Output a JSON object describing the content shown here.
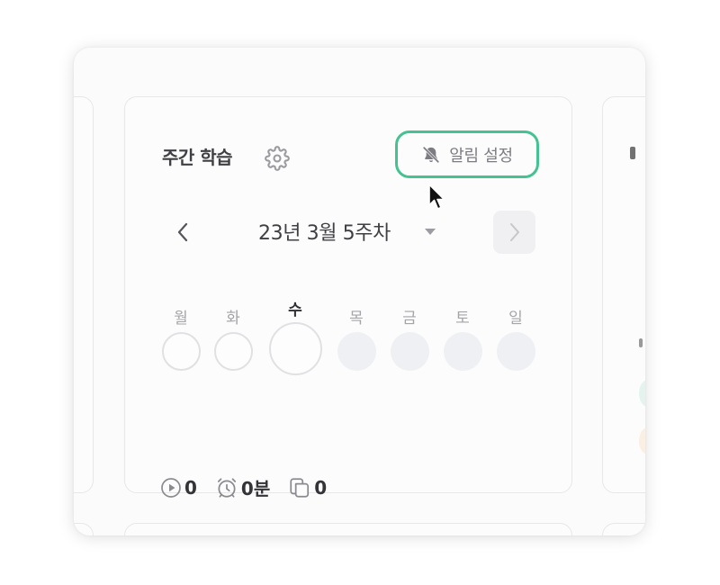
{
  "card": {
    "title": "주간 학습",
    "settings_icon": "gear-icon",
    "alarm_button": {
      "label": "알림 설정",
      "icon": "bell-off-icon"
    }
  },
  "week": {
    "label": "23년 3월 5주차",
    "prev_icon": "chevron-left-icon",
    "next_icon": "chevron-right-icon",
    "dropdown_icon": "caret-down-icon"
  },
  "days": [
    {
      "label": "월",
      "state": "outline"
    },
    {
      "label": "화",
      "state": "outline"
    },
    {
      "label": "수",
      "state": "today"
    },
    {
      "label": "목",
      "state": "future"
    },
    {
      "label": "금",
      "state": "future"
    },
    {
      "label": "토",
      "state": "future"
    },
    {
      "label": "일",
      "state": "future"
    }
  ],
  "stats": {
    "videos": "0",
    "time": "0분",
    "cards": "0"
  },
  "colors": {
    "accent": "#45c292",
    "text": "#3f3f44",
    "muted": "#a4a4aa",
    "border": "#e7e7e9",
    "filled_circle": "#eef0f3"
  }
}
